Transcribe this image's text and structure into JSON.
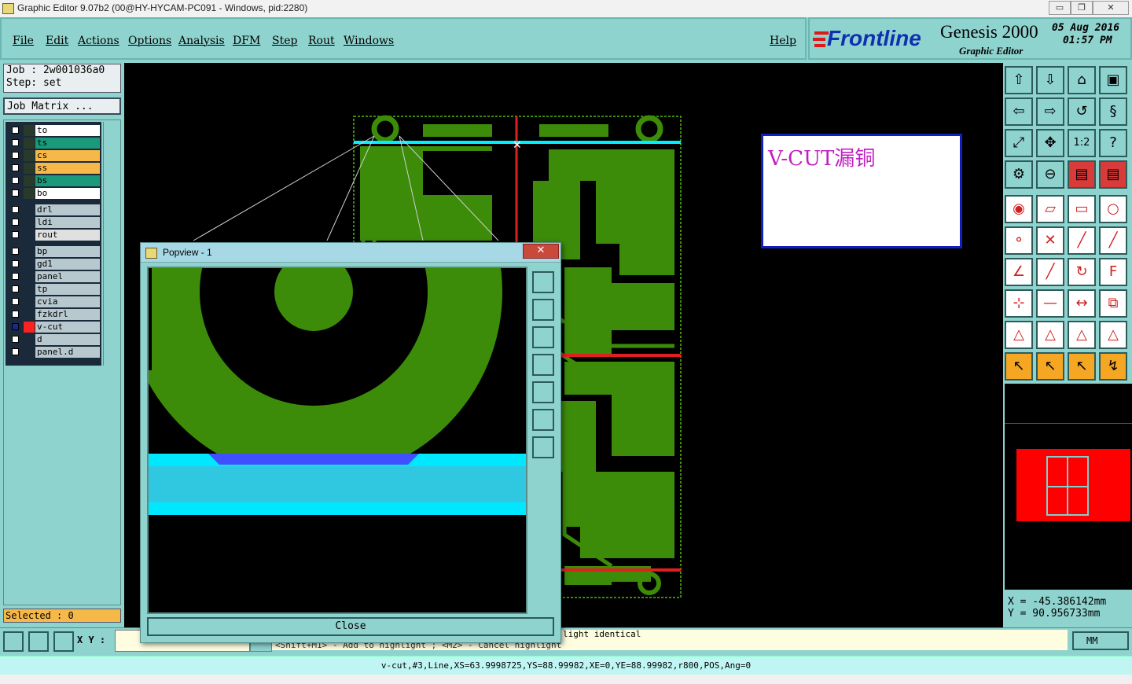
{
  "window": {
    "title": "Graphic Editor 9.07b2 (00@HY-HYCAM-PC091 - Windows, pid:2280)"
  },
  "menu": {
    "file": "File",
    "edit": "Edit",
    "actions": "Actions",
    "options": "Options",
    "analysis": "Analysis",
    "dfm": "DFM",
    "step": "Step",
    "rout": "Rout",
    "windows": "Windows",
    "help": "Help"
  },
  "brand": {
    "logo": "Frontline",
    "product": "Genesis 2000",
    "subtitle": "Graphic Editor",
    "date": "05 Aug 2016",
    "time": "01:57 PM"
  },
  "job": {
    "job_label": "Job : 2w001036a0",
    "step_label": "Step: set",
    "matrix_button": "Job Matrix ..."
  },
  "layers": [
    {
      "name": "to",
      "color": "#ffffff"
    },
    {
      "name": "ts",
      "color": "#1a9a7a"
    },
    {
      "name": "cs",
      "color": "#f7b84a"
    },
    {
      "name": "ss",
      "color": "#f7b84a"
    },
    {
      "name": "bs",
      "color": "#1a9a7a"
    },
    {
      "name": "bo",
      "color": "#ffffff"
    },
    {
      "name": "drl",
      "color": "#b8c8cf"
    },
    {
      "name": "ldi",
      "color": "#b8c8cf"
    },
    {
      "name": "rout",
      "color": "#e0e0e0"
    },
    {
      "name": "bp",
      "color": "#b8c8cf"
    },
    {
      "name": "gd1",
      "color": "#b8c8cf"
    },
    {
      "name": "panel",
      "color": "#b8c8cf"
    },
    {
      "name": "tp",
      "color": "#b8c8cf"
    },
    {
      "name": "cvia",
      "color": "#b8c8cf"
    },
    {
      "name": "fzkdrl",
      "color": "#b8c8cf"
    },
    {
      "name": "v-cut",
      "color": "#b8c8cf"
    },
    {
      "name": "d",
      "color": "#b8c8cf"
    },
    {
      "name": "panel.d",
      "color": "#b8c8cf"
    }
  ],
  "selected": {
    "label": "Selected : 0"
  },
  "annotation": {
    "text": "V-CUT漏铜"
  },
  "coords": {
    "x": "X = -45.386142mm",
    "y": "Y = 90.956733mm"
  },
  "popview": {
    "title": "Popview - 1",
    "close": "Close"
  },
  "bottom": {
    "xy_label": "X Y :",
    "message1": "light identical",
    "message2": "<Shift+M1> - Add to highlight ; <M2> - Cancel highlight",
    "units": "MM",
    "status": "v-cut,#3,Line,XS=63.9998725,YS=88.99982,XE=0,YE=88.99982,r800,POS,Ang=0"
  },
  "colors": {
    "accent": "#8fd3cf",
    "copper": "#3c8c0a",
    "vcut": "#00f0ff",
    "annotation_text": "#c020c0",
    "highlight": "#ff0000"
  }
}
